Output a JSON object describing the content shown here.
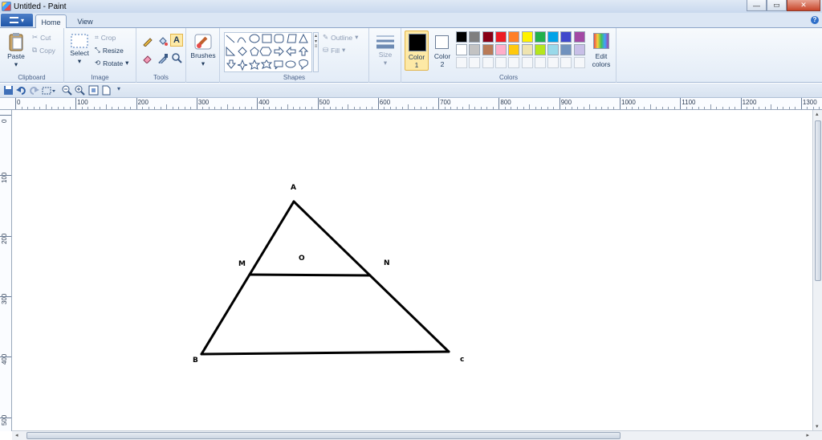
{
  "window": {
    "title": "Untitled - Paint",
    "controls": {
      "minimize": "—",
      "maximize": "▭",
      "close": "✕"
    }
  },
  "tabs": {
    "home": "Home",
    "view": "View"
  },
  "help": "?",
  "ribbon": {
    "clipboard": {
      "label": "Clipboard",
      "paste": "Paste",
      "cut": "Cut",
      "copy": "Copy"
    },
    "image": {
      "label": "Image",
      "select": "Select",
      "crop": "Crop",
      "resize": "Resize",
      "rotate": "Rotate"
    },
    "tools": {
      "label": "Tools"
    },
    "brushes": {
      "label": "Brushes"
    },
    "shapes": {
      "label": "Shapes",
      "outline": "Outline",
      "fill": "Fill"
    },
    "size": {
      "label": "Size"
    },
    "colors": {
      "label": "Colors",
      "color1": "Color\n1",
      "color1_a": "Color",
      "color1_b": "1",
      "color2_a": "Color",
      "color2_b": "2",
      "edit_a": "Edit",
      "edit_b": "colors",
      "color1_value": "#000000",
      "color2_value": "#ffffff",
      "palette_row1": [
        "#000000",
        "#7f7f7f",
        "#880015",
        "#ed1c24",
        "#ff7f27",
        "#fff200",
        "#22b14c",
        "#00a2e8",
        "#3f48cc",
        "#a349a4"
      ],
      "palette_row2": [
        "#ffffff",
        "#c3c3c3",
        "#b97a57",
        "#ffaec9",
        "#ffc90e",
        "#efe4b0",
        "#b5e61d",
        "#99d9ea",
        "#7092be",
        "#c8bfe7"
      ]
    }
  },
  "ruler": {
    "top": [
      "0",
      "100",
      "200",
      "300",
      "400",
      "500",
      "600",
      "700",
      "800",
      "900",
      "1000",
      "1100",
      "1200",
      "1300"
    ],
    "left": [
      "0",
      "100",
      "200",
      "300",
      "400",
      "500"
    ]
  },
  "canvas": {
    "labels": {
      "A": "A",
      "M": "M",
      "O": "O",
      "N": "N",
      "B": "B",
      "C": "c"
    }
  }
}
